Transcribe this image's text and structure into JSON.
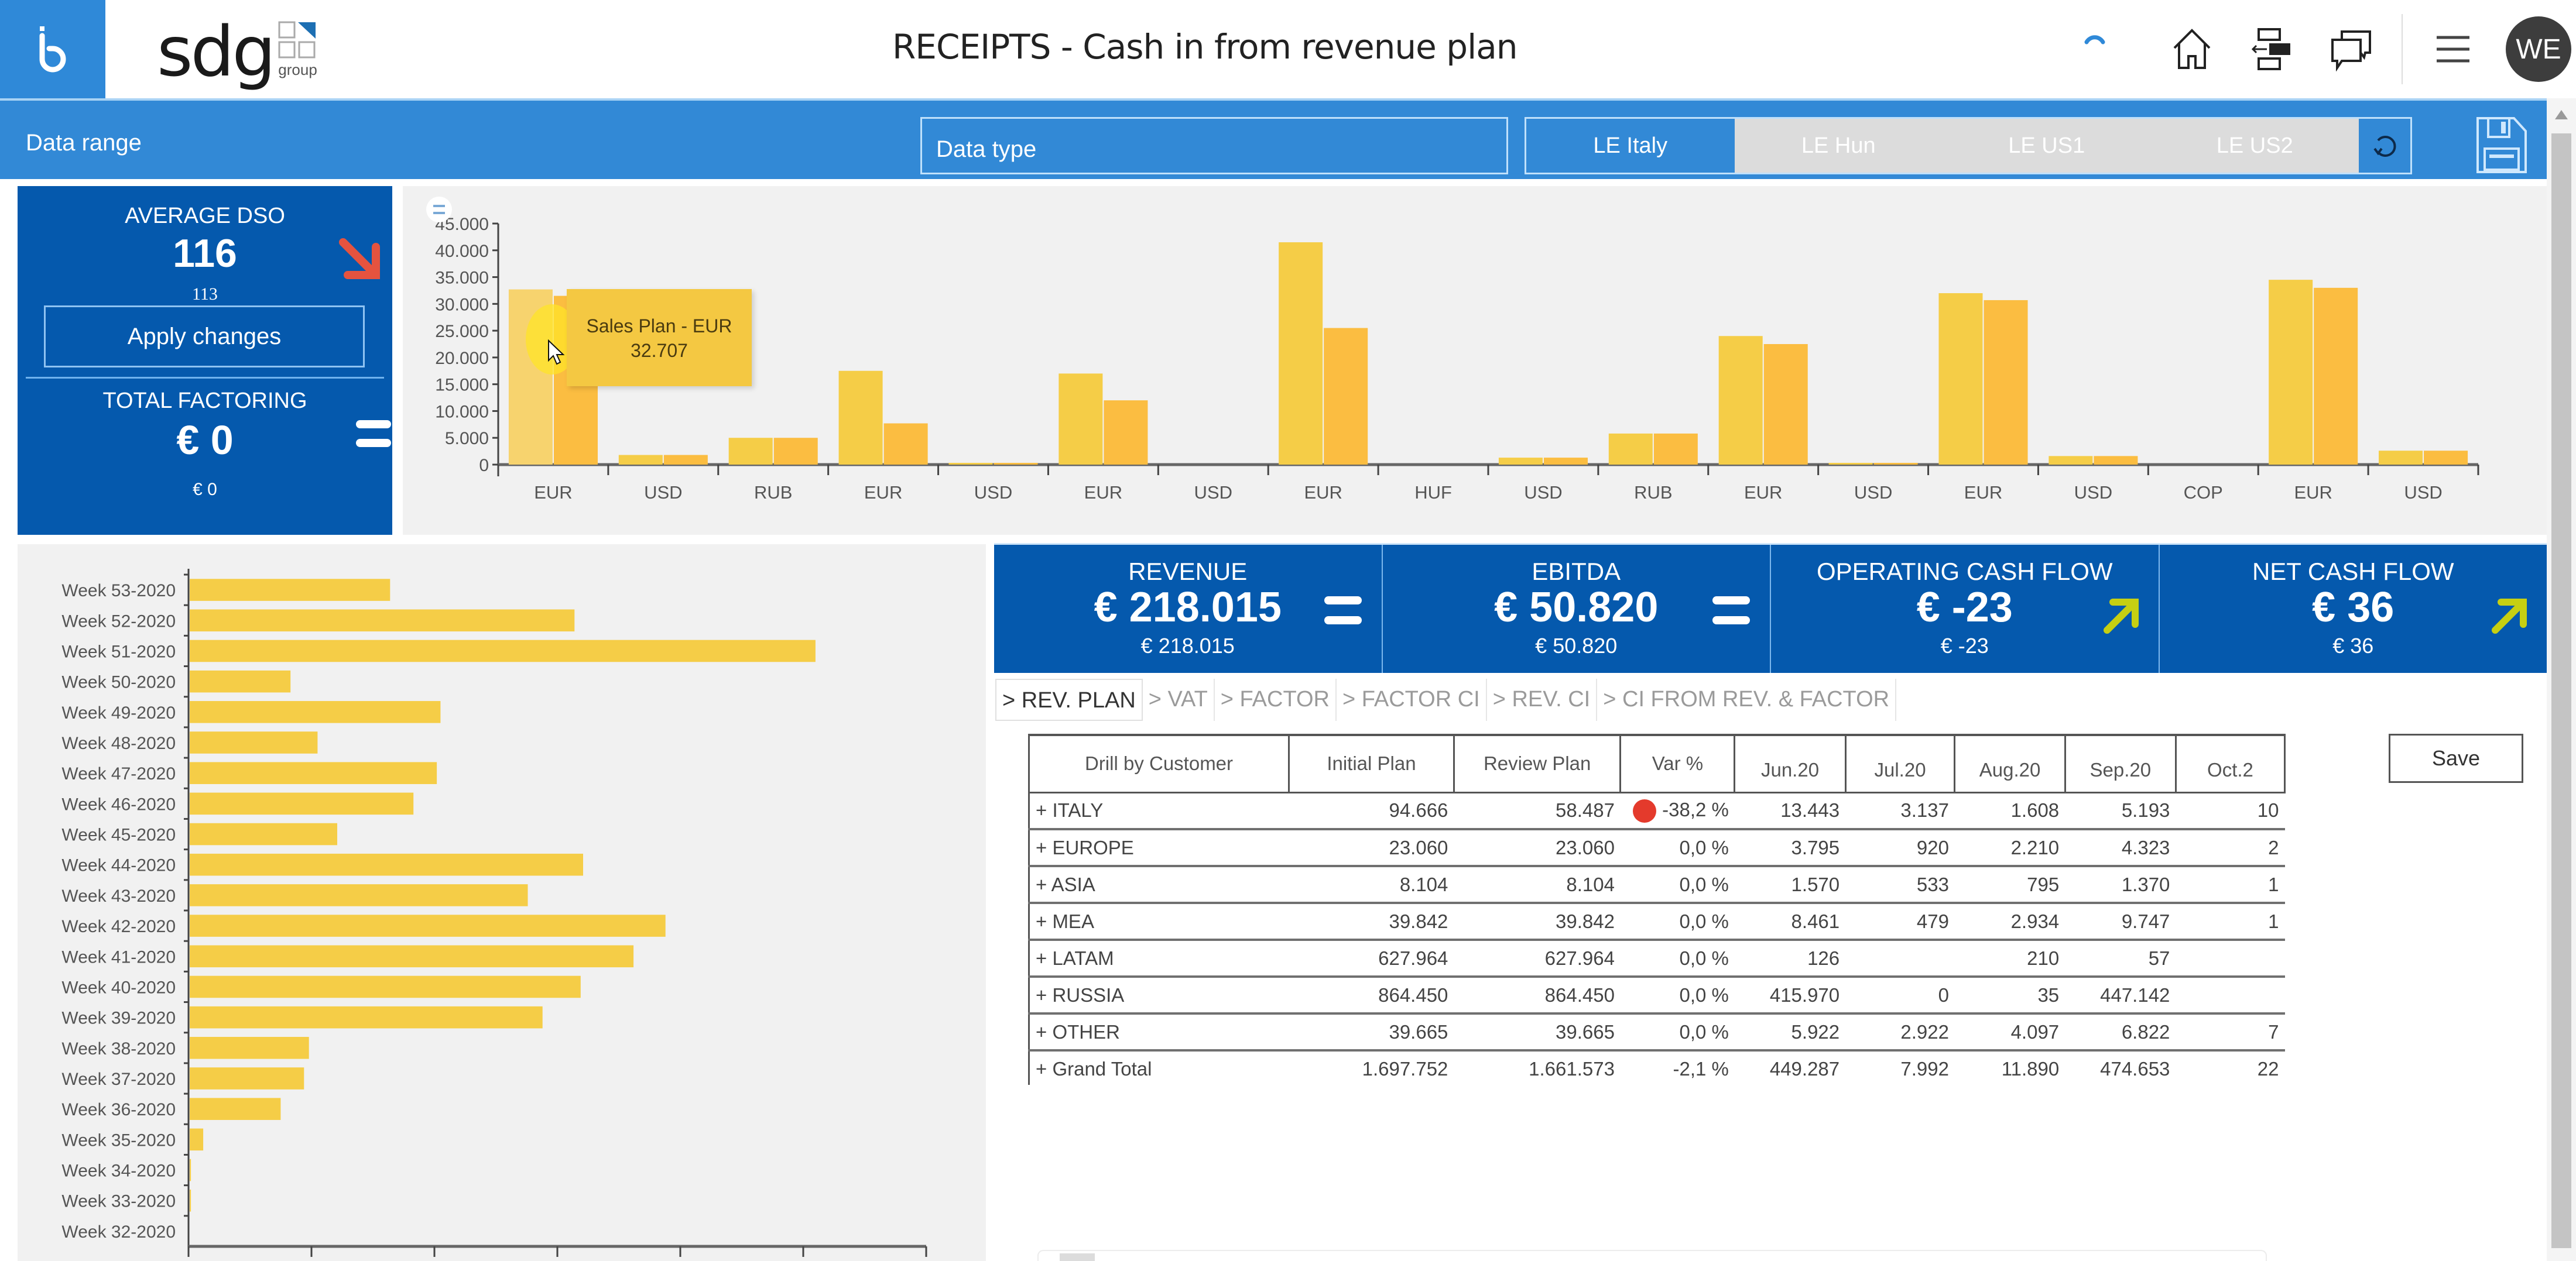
{
  "header": {
    "brand_icon": "b-logo-icon",
    "logo_text": "sdg",
    "logo_sub": "group",
    "title": "RECEIPTS - Cash in from revenue plan",
    "icons": [
      "loading-spinner-icon",
      "home-icon",
      "layout-icon",
      "comments-icon",
      "menu-icon"
    ],
    "avatar_initials": "WE"
  },
  "toolbar": {
    "data_range_label": "Data range",
    "data_type_label": "Data type",
    "legal_entities": [
      {
        "label": "LE Italy",
        "active": true
      },
      {
        "label": "LE Hun",
        "active": false
      },
      {
        "label": "LE US1",
        "active": false
      },
      {
        "label": "LE US2",
        "active": false
      }
    ],
    "refresh_icon": "refresh-icon",
    "save_icon": "floppy-disk-icon"
  },
  "kpi_left": {
    "dso_title": "AVERAGE DSO",
    "dso_value": "116",
    "dso_previous": "113",
    "dso_trend": "down",
    "apply_label": "Apply changes",
    "factoring_title": "TOTAL FACTORING",
    "factoring_value": "€ 0",
    "factoring_previous": "€ 0",
    "factoring_trend": "equal"
  },
  "kpis": [
    {
      "title": "REVENUE",
      "value": "€ 218.015",
      "previous": "€ 218.015",
      "trend": "equal"
    },
    {
      "title": "EBITDA",
      "value": "€ 50.820",
      "previous": "€ 50.820",
      "trend": "equal"
    },
    {
      "title": "OPERATING CASH FLOW",
      "value": "€ -23",
      "previous": "€ -23",
      "trend": "up"
    },
    {
      "title": "NET CASH FLOW",
      "value": "€ 36",
      "previous": "€ 36",
      "trend": "up"
    }
  ],
  "colors": {
    "primary_blue": "#3289d6",
    "kpi_blue": "#0559ad",
    "bar_series_1": "#f5cd47",
    "bar_series_2": "#fbbd41",
    "trend_down": "#e5533f",
    "trend_up": "#c6cf12",
    "var_negative": "#e43a2c"
  },
  "tabs": [
    {
      "label": "> REV. PLAN",
      "active": true
    },
    {
      "label": "> VAT",
      "active": false
    },
    {
      "label": "> FACTOR",
      "active": false
    },
    {
      "label": "> FACTOR CI",
      "active": false
    },
    {
      "label": "> REV. CI",
      "active": false
    },
    {
      "label": "> CI FROM REV. & FACTOR",
      "active": false
    }
  ],
  "table": {
    "columns": [
      "Drill by Customer",
      "Initial Plan",
      "Review Plan",
      "Var %",
      "Jun.20",
      "Jul.20",
      "Aug.20",
      "Sep.20",
      "Oct.2"
    ],
    "rows": [
      {
        "name": "+ ITALY",
        "initial": "94.666",
        "review": "58.487",
        "var": "-38,2 %",
        "var_flag": true,
        "jun": "13.443",
        "jul": "3.137",
        "aug": "1.608",
        "sep": "5.193",
        "oct": "10"
      },
      {
        "name": "+ EUROPE",
        "initial": "23.060",
        "review": "23.060",
        "var": "0,0 %",
        "var_flag": false,
        "jun": "3.795",
        "jul": "920",
        "aug": "2.210",
        "sep": "4.323",
        "oct": "2"
      },
      {
        "name": "+ ASIA",
        "initial": "8.104",
        "review": "8.104",
        "var": "0,0 %",
        "var_flag": false,
        "jun": "1.570",
        "jul": "533",
        "aug": "795",
        "sep": "1.370",
        "oct": "1"
      },
      {
        "name": "+ MEA",
        "initial": "39.842",
        "review": "39.842",
        "var": "0,0 %",
        "var_flag": false,
        "jun": "8.461",
        "jul": "479",
        "aug": "2.934",
        "sep": "9.747",
        "oct": "1"
      },
      {
        "name": "+ LATAM",
        "initial": "627.964",
        "review": "627.964",
        "var": "0,0 %",
        "var_flag": false,
        "jun": "126",
        "jul": "",
        "aug": "210",
        "sep": "57",
        "oct": ""
      },
      {
        "name": "+ RUSSIA",
        "initial": "864.450",
        "review": "864.450",
        "var": "0,0 %",
        "var_flag": false,
        "jun": "415.970",
        "jul": "0",
        "aug": "35",
        "sep": "447.142",
        "oct": ""
      },
      {
        "name": "+ OTHER",
        "initial": "39.665",
        "review": "39.665",
        "var": "0,0 %",
        "var_flag": false,
        "jun": "5.922",
        "jul": "2.922",
        "aug": "4.097",
        "sep": "6.822",
        "oct": "7"
      },
      {
        "name": "+ Grand Total",
        "initial": "1.697.752",
        "review": "1.661.573",
        "var": "-2,1 %",
        "var_flag": false,
        "jun": "449.287",
        "jul": "7.992",
        "aug": "11.890",
        "sep": "474.653",
        "oct": "22"
      }
    ],
    "save_label": "Save"
  },
  "chart_data": [
    {
      "type": "bar",
      "title": "",
      "xlabel": "",
      "ylabel": "",
      "categories": [
        "EUR",
        "USD",
        "RUB",
        "EUR",
        "USD",
        "EUR",
        "USD",
        "EUR",
        "HUF",
        "USD",
        "RUB",
        "EUR",
        "USD",
        "EUR",
        "USD",
        "COP",
        "EUR",
        "USD"
      ],
      "series": [
        {
          "name": "Sales Plan",
          "values": [
            32707,
            1800,
            5000,
            17500,
            300,
            17000,
            0,
            41500,
            0,
            1300,
            5800,
            24000,
            300,
            32000,
            1600,
            0,
            34500,
            2600
          ]
        },
        {
          "name": "Review Plan",
          "values": [
            31500,
            1800,
            5000,
            7700,
            300,
            12000,
            0,
            25500,
            0,
            1300,
            5800,
            22500,
            300,
            30700,
            1600,
            0,
            33000,
            2600
          ]
        }
      ],
      "yticks": [
        "0",
        "5.000",
        "10.000",
        "15.000",
        "20.000",
        "25.000",
        "30.000",
        "35.000",
        "40.000",
        "45.000"
      ],
      "ylim": [
        0,
        45000
      ],
      "grid": false,
      "tooltip": {
        "series": "Sales Plan - EUR",
        "value": "32.707",
        "category_index": 0
      }
    },
    {
      "type": "bar",
      "orientation": "horizontal",
      "title": "",
      "categories": [
        "Week 53-2020",
        "Week 52-2020",
        "Week 51-2020",
        "Week 50-2020",
        "Week 49-2020",
        "Week 48-2020",
        "Week 47-2020",
        "Week 46-2020",
        "Week 45-2020",
        "Week 44-2020",
        "Week 43-2020",
        "Week 42-2020",
        "Week 41-2020",
        "Week 40-2020",
        "Week 39-2020",
        "Week 38-2020",
        "Week 37-2020",
        "Week 36-2020",
        "Week 35-2020",
        "Week 34-2020",
        "Week 33-2020",
        "Week 32-2020"
      ],
      "values": [
        1.63,
        3.13,
        5.09,
        0.82,
        2.04,
        1.04,
        2.01,
        1.82,
        1.2,
        3.2,
        2.75,
        3.87,
        3.61,
        3.18,
        2.87,
        0.97,
        0.93,
        0.74,
        0.11,
        0.01,
        0.01,
        0
      ],
      "xlim": [
        0,
        6
      ],
      "x_tick_count": 7,
      "x_tick_labels_visible": false,
      "grid": false
    }
  ]
}
